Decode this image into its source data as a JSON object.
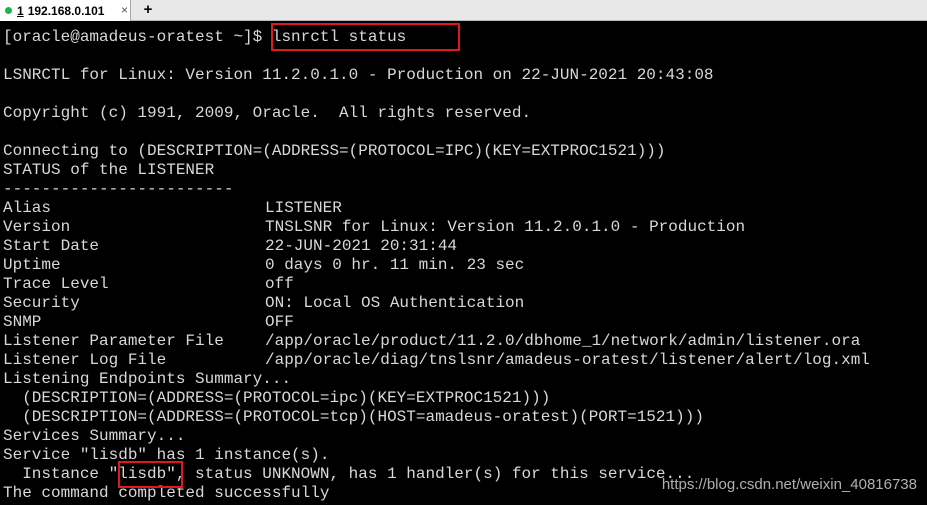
{
  "tab": {
    "number": "1",
    "host": "192.168.0.101",
    "close_glyph": "×",
    "new_tab_glyph": "+",
    "status_color": "#22b14c"
  },
  "terminal": {
    "prompt": "[oracle@amadeus-oratest ~]$ ",
    "command": "lsnrctl status",
    "version_line": "LSNRCTL for Linux: Version 11.2.0.1.0 - Production on 22-JUN-2021 20:43:08",
    "copyright_line": "Copyright (c) 1991, 2009, Oracle.  All rights reserved.",
    "connecting_line": "Connecting to (DESCRIPTION=(ADDRESS=(PROTOCOL=IPC)(KEY=EXTPROC1521)))",
    "status_header": "STATUS of the LISTENER",
    "separator": "------------------------",
    "fields": [
      {
        "key": "Alias",
        "value": "LISTENER"
      },
      {
        "key": "Version",
        "value": "TNSLSNR for Linux: Version 11.2.0.1.0 - Production"
      },
      {
        "key": "Start Date",
        "value": "22-JUN-2021 20:31:44"
      },
      {
        "key": "Uptime",
        "value": "0 days 0 hr. 11 min. 23 sec"
      },
      {
        "key": "Trace Level",
        "value": "off"
      },
      {
        "key": "Security",
        "value": "ON: Local OS Authentication"
      },
      {
        "key": "SNMP",
        "value": "OFF"
      },
      {
        "key": "Listener Parameter File",
        "value": "/app/oracle/product/11.2.0/dbhome_1/network/admin/listener.ora"
      },
      {
        "key": "Listener Log File",
        "value": "/app/oracle/diag/tnslsnr/amadeus-oratest/listener/alert/log.xml"
      }
    ],
    "endpoints_header": "Listening Endpoints Summary...",
    "endpoint_1": "  (DESCRIPTION=(ADDRESS=(PROTOCOL=ipc)(KEY=EXTPROC1521)))",
    "endpoint_2": "  (DESCRIPTION=(ADDRESS=(PROTOCOL=tcp)(HOST=amadeus-oratest)(PORT=1521)))",
    "services_header": "Services Summary...",
    "service_line": "Service \"lisdb\" has 1 instance(s).",
    "instance_prefix": "  Instance \"",
    "instance_name": "lisdb",
    "instance_suffix": "\", status UNKNOWN, has 1 handler(s) for this service...",
    "completed_line": "The command completed successfully",
    "highlight_color": "#e0181c"
  },
  "watermark": "https://blog.csdn.net/weixin_40816738"
}
